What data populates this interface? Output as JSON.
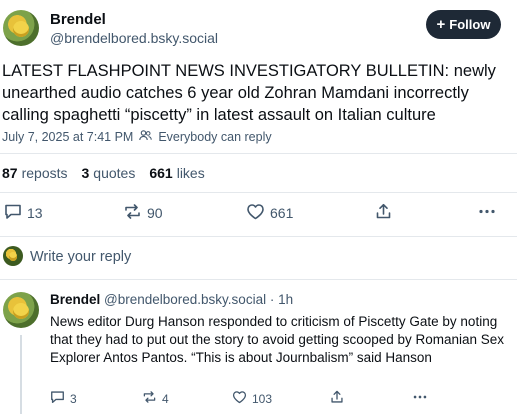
{
  "post": {
    "author_name": "Brendel",
    "author_handle": "@brendelbored.bsky.social",
    "follow_label": "Follow",
    "text": "LATEST FLASHPOINT NEWS INVESTIGATORY BULLETIN: newly unearthed audio catches 6 year old Zohran Mamdani incorrectly calling spaghetti “piscetty” in latest assault on Italian culture",
    "timestamp": "July 7, 2025 at 7:41 PM",
    "reply_permission": "Everybody can reply",
    "reposts_count": "87",
    "reposts_label": "reposts",
    "quotes_count": "3",
    "quotes_label": "quotes",
    "likes_count": "661",
    "likes_label": "likes",
    "reply_count": "13",
    "repost_count": "90",
    "like_count": "661"
  },
  "composer": {
    "placeholder": "Write your reply"
  },
  "reply": {
    "author_name": "Brendel",
    "author_handle": "@brendelbored.bsky.social",
    "separator": "·",
    "age": "1h",
    "text": "News editor Durg Hanson responded to criticism of Piscetty Gate by noting that they had to put out the story to avoid getting scooped by Romanian Sex Explorer Antos Pantos. “This is about Journbalism” said Hanson",
    "reply_count": "3",
    "repost_count": "4",
    "like_count": "103"
  },
  "colors": {
    "text": "#0b0f14",
    "muted": "#42576c",
    "follow_bg": "#1e2936",
    "divider": "#e4e8ec"
  },
  "icons": [
    "reply-icon",
    "repost-icon",
    "like-icon",
    "share-icon",
    "more-icon",
    "plus-icon",
    "people-icon"
  ]
}
